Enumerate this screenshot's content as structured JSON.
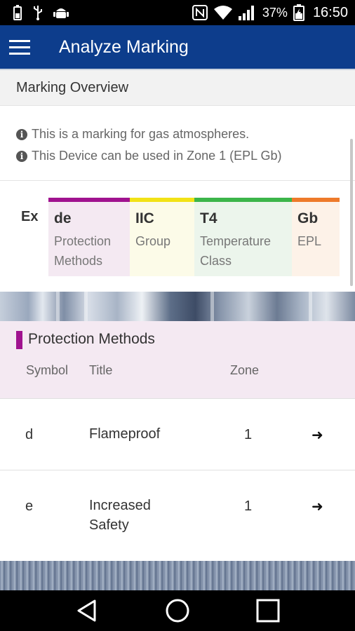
{
  "status_bar": {
    "battery_percent": "37%",
    "time": "16:50",
    "icons": [
      "battery-icon",
      "usb-icon",
      "android-icon",
      "nfc-icon",
      "wifi-icon",
      "signal-icon",
      "battery-charging-icon"
    ]
  },
  "app_bar": {
    "title": "Analyze Marking",
    "menu_icon": "hamburger-menu-icon",
    "background": "#0d3d8c"
  },
  "overview": {
    "header": "Marking Overview",
    "info": [
      "This is a marking for gas atmospheres.",
      "This Device can be used in Zone 1 (EPL Gb)"
    ]
  },
  "marking": {
    "prefix": "Ex",
    "segments": [
      {
        "code": "de",
        "line1": "Protection",
        "line2": "Methods",
        "accent": "#a0128f",
        "bg": "#f4e9f2"
      },
      {
        "code": "IIC",
        "line1": "Group",
        "line2": "",
        "accent": "#f2e216",
        "bg": "#fcfbe8"
      },
      {
        "code": "T4",
        "line1": "Temperature",
        "line2": "Class",
        "accent": "#3cb54a",
        "bg": "#ecf5ec"
      },
      {
        "code": "Gb",
        "line1": "EPL",
        "line2": "",
        "accent": "#ee7a2a",
        "bg": "#fdf2e8"
      }
    ]
  },
  "protection_methods": {
    "title": "Protection Methods",
    "accent": "#a0128f",
    "columns": {
      "symbol": "Symbol",
      "title": "Title",
      "zone": "Zone"
    },
    "rows": [
      {
        "symbol": "d",
        "title_line1": "Flameproof",
        "title_line2": "",
        "zone": "1",
        "arrow": "➜"
      },
      {
        "symbol": "e",
        "title_line1": "Increased",
        "title_line2": "Safety",
        "zone": "1",
        "arrow": "➜"
      }
    ]
  },
  "nav_bar": {
    "icons": [
      "back-icon",
      "home-icon",
      "recents-icon"
    ]
  }
}
